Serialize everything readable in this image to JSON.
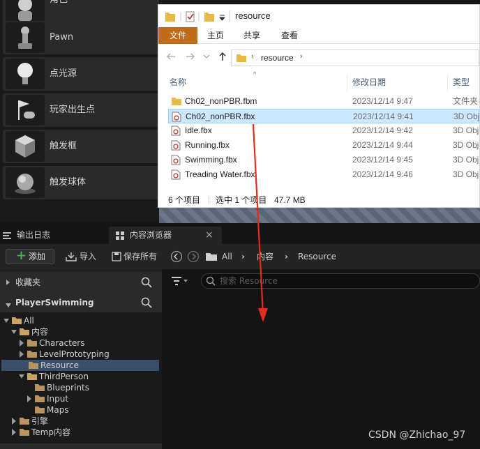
{
  "placement": {
    "items": [
      {
        "label": "角色",
        "icon": "character-icon"
      },
      {
        "label": "Pawn",
        "icon": "pawn-icon"
      },
      {
        "label": "点光源",
        "icon": "point-light-icon"
      },
      {
        "label": "玩家出生点",
        "icon": "player-start-icon"
      },
      {
        "label": "触发框",
        "icon": "trigger-box-icon"
      },
      {
        "label": "触发球体",
        "icon": "trigger-sphere-icon"
      }
    ],
    "help": "?"
  },
  "explorer": {
    "title": "resource",
    "ribbon_tabs": [
      "文件",
      "主页",
      "共享",
      "查看"
    ],
    "address": "resource",
    "columns": {
      "name": "名称",
      "date": "修改日期",
      "type": "类型"
    },
    "files": [
      {
        "name": "Ch02_nonPBR.fbm",
        "date": "2023/12/14 9:47",
        "type": "文件夹",
        "kind": "folder"
      },
      {
        "name": "Ch02_nonPBR.fbx",
        "date": "2023/12/14 9:41",
        "type": "3D Obj",
        "kind": "fbx"
      },
      {
        "name": "Idle.fbx",
        "date": "2023/12/14 9:42",
        "type": "3D Obj",
        "kind": "fbx"
      },
      {
        "name": "Running.fbx",
        "date": "2023/12/14 9:44",
        "type": "3D Obj",
        "kind": "fbx"
      },
      {
        "name": "Swimming.fbx",
        "date": "2023/12/14 9:45",
        "type": "3D Obj",
        "kind": "fbx"
      },
      {
        "name": "Treading Water.fbx",
        "date": "2023/12/14 9:46",
        "type": "3D Obj",
        "kind": "fbx"
      }
    ],
    "status": {
      "count": "6 个项目",
      "selected": "选中 1 个项目",
      "size": "47.7 MB"
    }
  },
  "tabs": {
    "output_log": "输出日志",
    "content_browser": "内容浏览器",
    "close": "×"
  },
  "toolbar": {
    "add": "添加",
    "import": "导入",
    "save_all": "保存所有",
    "breadcrumb": [
      "All",
      "内容",
      "Resource"
    ]
  },
  "sources": {
    "favorites": "收藏夹",
    "project": "PlayerSwimming",
    "tree": [
      {
        "label": "All",
        "level": 0,
        "open": true
      },
      {
        "label": "内容",
        "level": 1,
        "open": true
      },
      {
        "label": "Characters",
        "level": 2,
        "open": false
      },
      {
        "label": "LevelPrototyping",
        "level": 2,
        "open": false
      },
      {
        "label": "Resource",
        "level": 2,
        "open": false,
        "selected": true,
        "leaf": true
      },
      {
        "label": "ThirdPerson",
        "level": 2,
        "open": true
      },
      {
        "label": "Blueprints",
        "level": 3,
        "leaf": true
      },
      {
        "label": "Input",
        "level": 3,
        "open": false
      },
      {
        "label": "Maps",
        "level": 3,
        "leaf": true
      },
      {
        "label": "引擎",
        "level": 1,
        "open": false
      },
      {
        "label": "Temp内容",
        "level": 1,
        "open": false
      }
    ]
  },
  "asset_search": {
    "placeholder": "搜索 Resource"
  },
  "watermark": "CSDN @Zhichao_97",
  "colors": {
    "arrow": "#e8291c",
    "selection": "#cce8ff",
    "folder": "#e8b94a",
    "ue_add": "#46b34a"
  }
}
